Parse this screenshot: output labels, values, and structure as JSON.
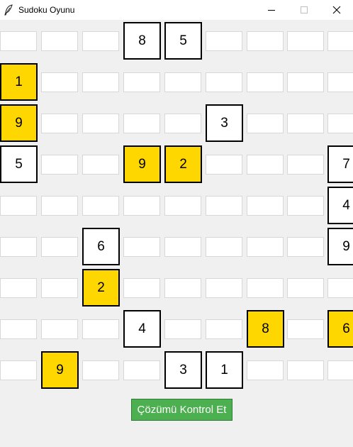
{
  "window": {
    "title": "Sudoku Oyunu",
    "icons": {
      "app": "feather-icon",
      "minimize": "minimize-icon",
      "maximize": "maximize-icon",
      "close": "close-icon"
    }
  },
  "colors": {
    "hint_fill": "#ffd700",
    "given_fill": "#ffffff",
    "button_fill": "#4caf50",
    "background": "#f0f0f0"
  },
  "grid": {
    "rows": [
      [
        {
          "v": "",
          "t": "empty"
        },
        {
          "v": "",
          "t": "empty"
        },
        {
          "v": "",
          "t": "empty"
        },
        {
          "v": "8",
          "t": "given"
        },
        {
          "v": "5",
          "t": "given"
        },
        {
          "v": "",
          "t": "empty"
        },
        {
          "v": "",
          "t": "empty"
        },
        {
          "v": "",
          "t": "empty"
        },
        {
          "v": "",
          "t": "empty"
        }
      ],
      [
        {
          "v": "1",
          "t": "hint"
        },
        {
          "v": "",
          "t": "empty"
        },
        {
          "v": "",
          "t": "empty"
        },
        {
          "v": "",
          "t": "empty"
        },
        {
          "v": "",
          "t": "empty"
        },
        {
          "v": "",
          "t": "empty"
        },
        {
          "v": "",
          "t": "empty"
        },
        {
          "v": "",
          "t": "empty"
        },
        {
          "v": "",
          "t": "empty"
        }
      ],
      [
        {
          "v": "9",
          "t": "hint"
        },
        {
          "v": "",
          "t": "empty"
        },
        {
          "v": "",
          "t": "empty"
        },
        {
          "v": "",
          "t": "empty"
        },
        {
          "v": "",
          "t": "empty"
        },
        {
          "v": "3",
          "t": "given"
        },
        {
          "v": "",
          "t": "empty"
        },
        {
          "v": "",
          "t": "empty"
        },
        {
          "v": "",
          "t": "empty"
        }
      ],
      [
        {
          "v": "5",
          "t": "given"
        },
        {
          "v": "",
          "t": "empty"
        },
        {
          "v": "",
          "t": "empty"
        },
        {
          "v": "9",
          "t": "hint"
        },
        {
          "v": "2",
          "t": "hint"
        },
        {
          "v": "",
          "t": "empty"
        },
        {
          "v": "",
          "t": "empty"
        },
        {
          "v": "",
          "t": "empty"
        },
        {
          "v": "7",
          "t": "given"
        }
      ],
      [
        {
          "v": "",
          "t": "empty"
        },
        {
          "v": "",
          "t": "empty"
        },
        {
          "v": "",
          "t": "empty"
        },
        {
          "v": "",
          "t": "empty"
        },
        {
          "v": "",
          "t": "empty"
        },
        {
          "v": "",
          "t": "empty"
        },
        {
          "v": "",
          "t": "empty"
        },
        {
          "v": "",
          "t": "empty"
        },
        {
          "v": "4",
          "t": "given"
        }
      ],
      [
        {
          "v": "",
          "t": "empty"
        },
        {
          "v": "",
          "t": "empty"
        },
        {
          "v": "6",
          "t": "given"
        },
        {
          "v": "",
          "t": "empty"
        },
        {
          "v": "",
          "t": "empty"
        },
        {
          "v": "",
          "t": "empty"
        },
        {
          "v": "",
          "t": "empty"
        },
        {
          "v": "",
          "t": "empty"
        },
        {
          "v": "9",
          "t": "given"
        }
      ],
      [
        {
          "v": "",
          "t": "empty"
        },
        {
          "v": "",
          "t": "empty"
        },
        {
          "v": "2",
          "t": "hint"
        },
        {
          "v": "",
          "t": "empty"
        },
        {
          "v": "",
          "t": "empty"
        },
        {
          "v": "",
          "t": "empty"
        },
        {
          "v": "",
          "t": "empty"
        },
        {
          "v": "",
          "t": "empty"
        },
        {
          "v": "",
          "t": "empty"
        }
      ],
      [
        {
          "v": "",
          "t": "empty"
        },
        {
          "v": "",
          "t": "empty"
        },
        {
          "v": "",
          "t": "empty"
        },
        {
          "v": "4",
          "t": "given"
        },
        {
          "v": "",
          "t": "empty"
        },
        {
          "v": "",
          "t": "empty"
        },
        {
          "v": "8",
          "t": "hint"
        },
        {
          "v": "",
          "t": "empty"
        },
        {
          "v": "6",
          "t": "hint"
        }
      ],
      [
        {
          "v": "",
          "t": "empty"
        },
        {
          "v": "9",
          "t": "hint"
        },
        {
          "v": "",
          "t": "empty"
        },
        {
          "v": "",
          "t": "empty"
        },
        {
          "v": "3",
          "t": "given"
        },
        {
          "v": "1",
          "t": "given"
        },
        {
          "v": "",
          "t": "empty"
        },
        {
          "v": "",
          "t": "empty"
        },
        {
          "v": "",
          "t": "empty"
        }
      ]
    ]
  },
  "check_button": {
    "label": "Çözümü Kontrol Et"
  }
}
